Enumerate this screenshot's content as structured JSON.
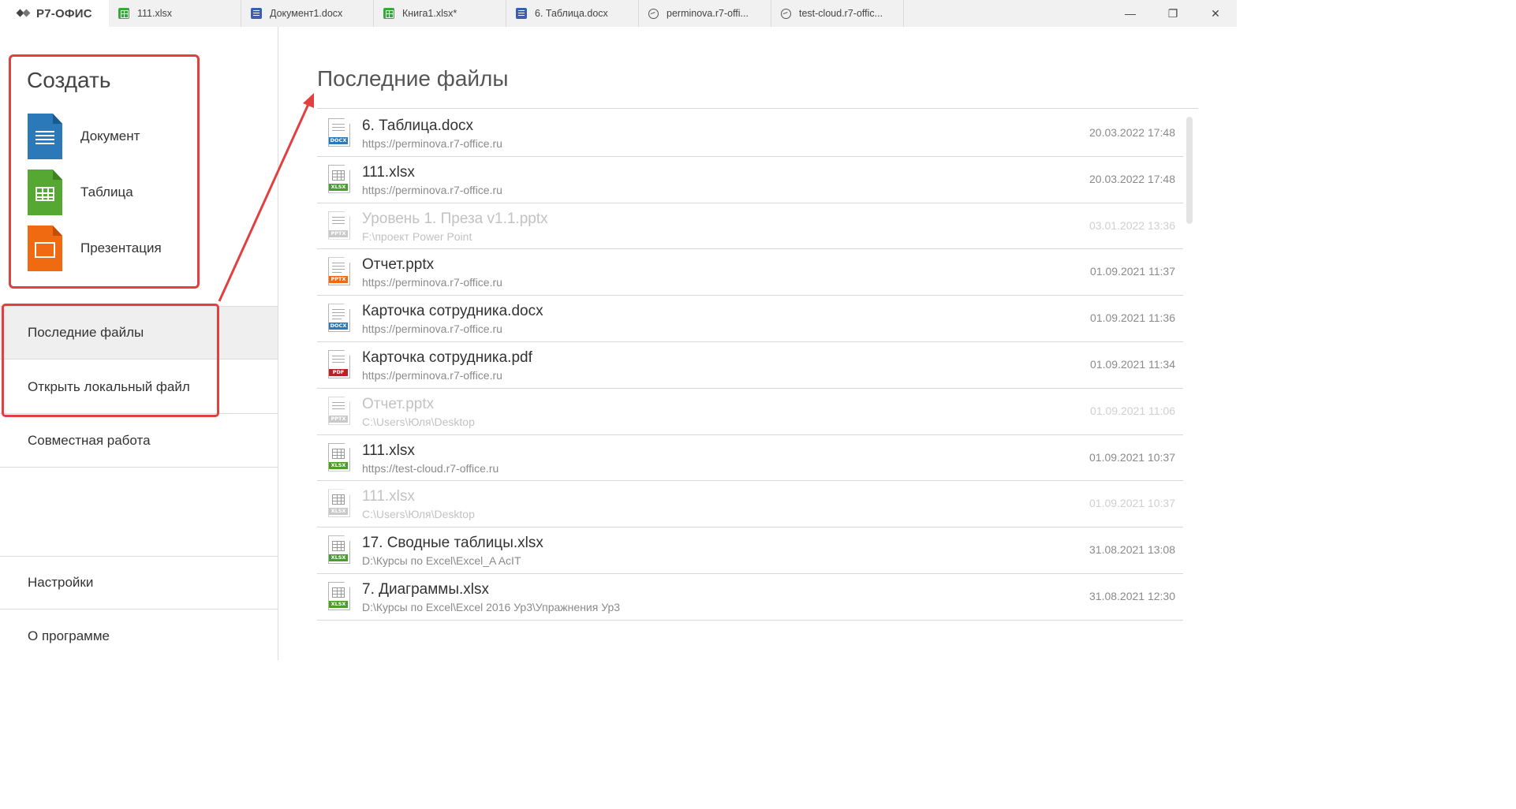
{
  "app": {
    "brand": "Р7-ОФИС"
  },
  "tabs": [
    {
      "label": "111.xlsx",
      "icon": "xlsx-icon",
      "type": "xlsx"
    },
    {
      "label": "Документ1.docx",
      "icon": "docx-icon",
      "type": "docx"
    },
    {
      "label": "Книга1.xlsx*",
      "icon": "xlsx-icon",
      "type": "xlsx"
    },
    {
      "label": "6. Таблица.docx",
      "icon": "docx-icon",
      "type": "docx"
    },
    {
      "label": "perminova.r7-offi...",
      "icon": "cloud-icon",
      "type": "cloud"
    },
    {
      "label": "test-cloud.r7-offic...",
      "icon": "cloud-icon",
      "type": "cloud"
    }
  ],
  "window_controls": {
    "minimize": "—",
    "restore": "❐",
    "close": "✕"
  },
  "create": {
    "title": "Создать",
    "items": [
      {
        "label": "Документ",
        "icon": "document-icon"
      },
      {
        "label": "Таблица",
        "icon": "spreadsheet-icon"
      },
      {
        "label": "Презентация",
        "icon": "presentation-icon"
      }
    ]
  },
  "nav": {
    "recent": "Последние файлы",
    "open_local": "Открыть локальный файл",
    "collab": "Совместная работа",
    "settings": "Настройки",
    "about": "О программе"
  },
  "main": {
    "title": "Последние файлы",
    "files": [
      {
        "name": "6. Таблица.docx",
        "path": "https://perminova.r7-office.ru",
        "date": "20.03.2022 17:48",
        "type": "docx",
        "badge": "DOCX",
        "dim": false
      },
      {
        "name": "111.xlsx",
        "path": "https://perminova.r7-office.ru",
        "date": "20.03.2022 17:48",
        "type": "xlsx",
        "badge": "XLSX",
        "dim": false
      },
      {
        "name": "Уровень 1. Преза v1.1.pptx",
        "path": "F:\\проект Power Point",
        "date": "03.01.2022 13:36",
        "type": "pptx",
        "badge": "PPTX",
        "dim": true
      },
      {
        "name": "Отчет.pptx",
        "path": "https://perminova.r7-office.ru",
        "date": "01.09.2021 11:37",
        "type": "pptx",
        "badge": "PPTX",
        "dim": false
      },
      {
        "name": "Карточка сотрудника.docx",
        "path": "https://perminova.r7-office.ru",
        "date": "01.09.2021 11:36",
        "type": "docx",
        "badge": "DOCX",
        "dim": false
      },
      {
        "name": "Карточка сотрудника.pdf",
        "path": "https://perminova.r7-office.ru",
        "date": "01.09.2021 11:34",
        "type": "pdf",
        "badge": "PDF",
        "dim": false
      },
      {
        "name": "Отчет.pptx",
        "path": "C:\\Users\\Юля\\Desktop",
        "date": "01.09.2021 11:06",
        "type": "pptx",
        "badge": "PPTX",
        "dim": true
      },
      {
        "name": "111.xlsx",
        "path": "https://test-cloud.r7-office.ru",
        "date": "01.09.2021 10:37",
        "type": "xlsx",
        "badge": "XLSX",
        "dim": false
      },
      {
        "name": "111.xlsx",
        "path": "C:\\Users\\Юля\\Desktop",
        "date": "01.09.2021 10:37",
        "type": "xlsx",
        "badge": "XLSX",
        "dim": true
      },
      {
        "name": "17. Сводные таблицы.xlsx",
        "path": "D:\\Курсы по Excel\\Excel_A AcIT",
        "date": "31.08.2021 13:08",
        "type": "xlsx",
        "badge": "XLSX",
        "dim": false
      },
      {
        "name": "7. Диаграммы.xlsx",
        "path": "D:\\Курсы по Excel\\Excel 2016 Ур3\\Упражнения Ур3",
        "date": "31.08.2021 12:30",
        "type": "xlsx",
        "badge": "XLSX",
        "dim": false
      }
    ]
  },
  "colors": {
    "highlight": "#e04040",
    "doc": "#2b79b8",
    "sheet": "#55a832",
    "pres": "#ef6a10",
    "pdf": "#b32525"
  }
}
